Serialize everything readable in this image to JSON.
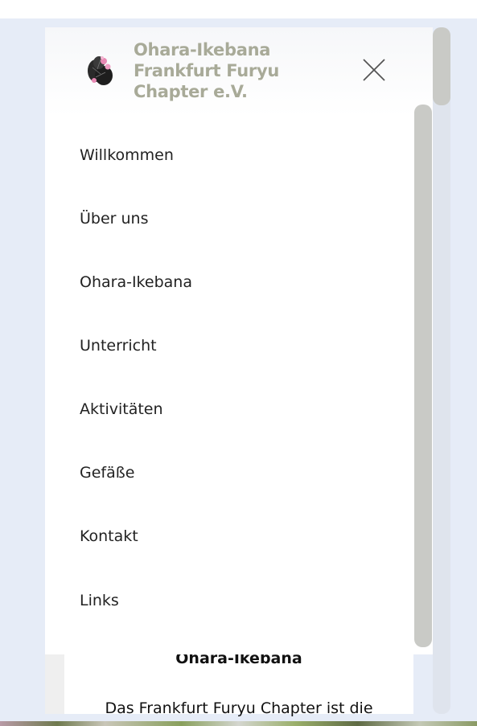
{
  "brand": {
    "line1": "Ohara-Ikebana",
    "line2": "Frankfurt Furyu",
    "line3": "Chapter e.V.",
    "color": "#a8aa98",
    "logo_icon": "ikebana-flower-logo"
  },
  "close_icon": "close-x-icon",
  "menu": {
    "items": [
      {
        "label": "Willkommen"
      },
      {
        "label": "Über uns"
      },
      {
        "label": "Ohara-Ikebana"
      },
      {
        "label": "Unterricht"
      },
      {
        "label": "Aktivitäten"
      },
      {
        "label": "Gefäße"
      },
      {
        "label": "Kontakt"
      },
      {
        "label": "Links"
      }
    ]
  },
  "page": {
    "heading": "Ohara-Ikebana",
    "paragraph_start": "Das Frankfurt Furyu Chapter ist die"
  },
  "colors": {
    "background": "#e6ecf7",
    "scrollbar_thumb": "#c9cac6",
    "menu_text": "#222222"
  }
}
